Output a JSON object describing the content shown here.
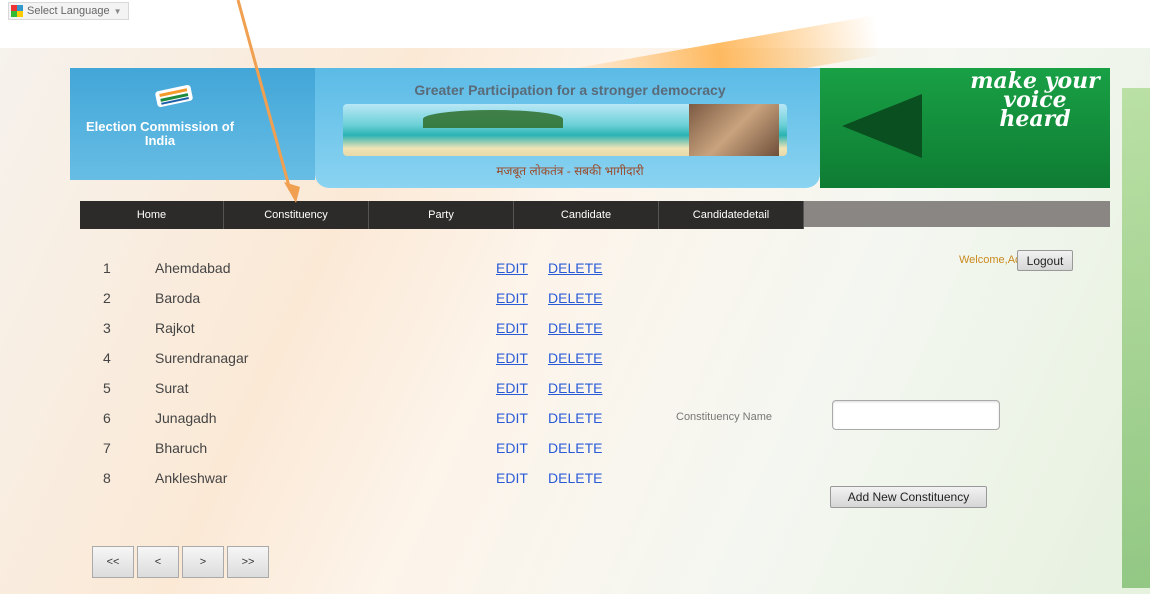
{
  "language_selector": {
    "label": "Select Language",
    "arrow": "▼"
  },
  "header": {
    "logo_text": "Election Commission of India",
    "tagline": "Greater Participation for a stronger democracy",
    "hindi_slogan": "मजबूत लोकतंत्र - सबकी भागीदारी",
    "voice_text": "make your voice heard"
  },
  "nav": {
    "items": [
      "Home",
      "Constituency",
      "Party",
      "Candidate",
      "Candidatedetail"
    ]
  },
  "user": {
    "welcome": "Welcome,Admin",
    "logout": "Logout"
  },
  "rows": [
    {
      "num": "1",
      "name": "Ahemdabad",
      "edit": "EDIT",
      "delete": "DELETE"
    },
    {
      "num": "2",
      "name": "Baroda",
      "edit": "EDIT",
      "delete": "DELETE"
    },
    {
      "num": "3",
      "name": "Rajkot",
      "edit": "EDIT",
      "delete": "DELETE"
    },
    {
      "num": "4",
      "name": "Surendranagar",
      "edit": "EDIT",
      "delete": "DELETE"
    },
    {
      "num": "5",
      "name": "Surat",
      "edit": "EDIT",
      "delete": "DELETE"
    },
    {
      "num": "6",
      "name": "Junagadh",
      "edit": "EDIT",
      "delete": "DELETE"
    },
    {
      "num": "7",
      "name": "Bharuch",
      "edit": "EDIT",
      "delete": "DELETE"
    },
    {
      "num": "8",
      "name": "Ankleshwar",
      "edit": "EDIT",
      "delete": "DELETE"
    }
  ],
  "form": {
    "label": "Constituency Name",
    "input_value": "",
    "add_button": "Add New Constituency"
  },
  "pager": {
    "first": "<<",
    "prev": "<",
    "next": ">",
    "last": ">>"
  },
  "colors": {
    "link": "#2a5bd7",
    "welcome": "#c98a1d",
    "nav_bg": "#2d2b29",
    "header_blue": "#42a6d8",
    "header_green": "#19a045",
    "annotation_arrow": "#f0a050"
  }
}
